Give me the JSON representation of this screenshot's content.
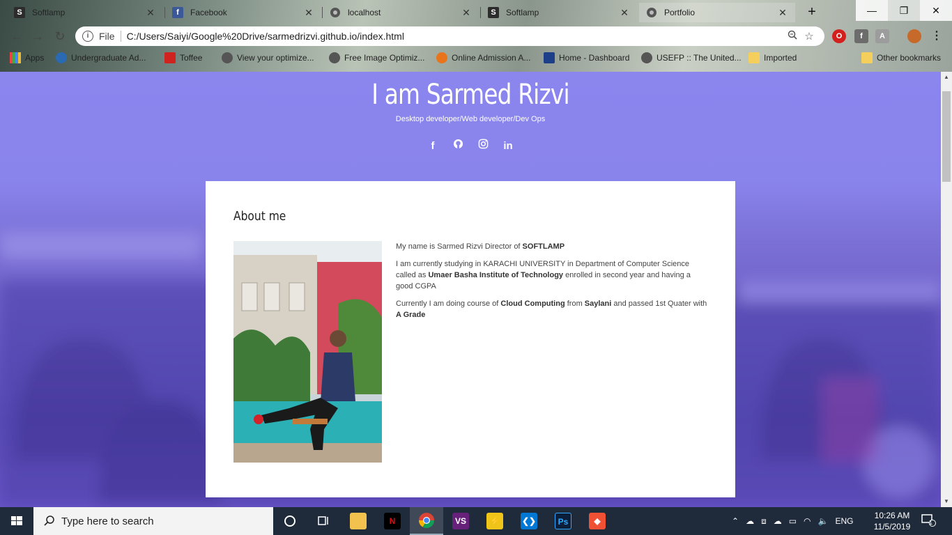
{
  "browser": {
    "tabs": [
      {
        "title": "Softlamp",
        "icon": "softlamp-icon"
      },
      {
        "title": "Facebook",
        "icon": "facebook-icon"
      },
      {
        "title": "localhost",
        "icon": "globe-icon"
      },
      {
        "title": "Softlamp",
        "icon": "softlamp-icon"
      },
      {
        "title": "Portfolio",
        "icon": "globe-icon"
      }
    ],
    "address": {
      "scheme_label": "File",
      "url": "C:/Users/Saiyi/Google%20Drive/sarmedrizvi.github.io/index.html"
    },
    "bookmarks": [
      {
        "label": "Apps"
      },
      {
        "label": "Undergraduate Ad..."
      },
      {
        "label": "Toffee"
      },
      {
        "label": "View your optimize..."
      },
      {
        "label": "Free Image Optimiz..."
      },
      {
        "label": "Online Admission A..."
      },
      {
        "label": "Home - Dashboard"
      },
      {
        "label": "USEFP :: The United..."
      },
      {
        "label": "Imported"
      },
      {
        "label": "Other bookmarks"
      }
    ]
  },
  "hero": {
    "name": "I am Sarmed Rizvi",
    "subtitle": "Desktop developer/Web developer/Dev Ops",
    "social": [
      "facebook-icon",
      "github-icon",
      "instagram-icon",
      "linkedin-icon"
    ]
  },
  "about": {
    "heading": "About me",
    "p1_pre": "My name is Sarmed Rizvi Director of ",
    "p1_bold": "SOFTLAMP",
    "p2_pre": "I am currently studying in KARACHI UNIVERSITY in Department of Computer Science called as ",
    "p2_bold": "Umaer Basha Institute of Technology",
    "p2_post": " enrolled in second year and having a good CGPA",
    "p3_pre": "Currently I am doing course of ",
    "p3_bold1": "Cloud Computing",
    "p3_mid1": " from ",
    "p3_bold2": "Saylani",
    "p3_mid2": " and passed 1st Quater with ",
    "p3_bold3": "A Grade"
  },
  "taskbar": {
    "search_placeholder": "Type here to search",
    "language": "ENG",
    "time": "10:26 AM",
    "date": "11/5/2019",
    "notification_count": "1"
  },
  "colors": {
    "hero_bg": "#8b85ee",
    "card_bg": "#ffffff",
    "taskbar_bg": "#1f2a3a"
  }
}
